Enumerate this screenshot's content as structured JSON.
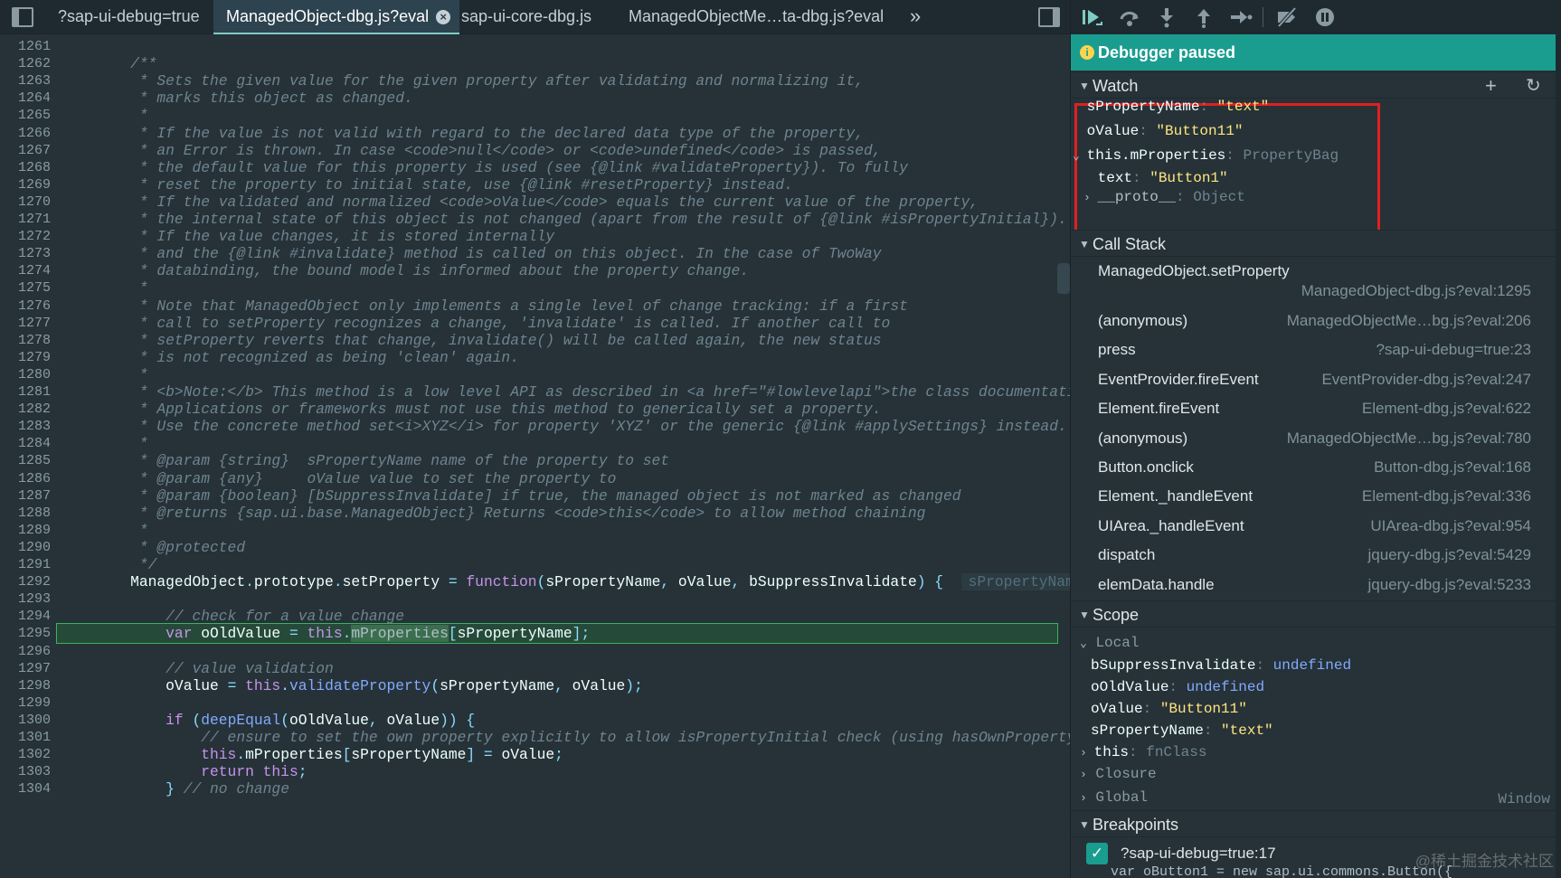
{
  "editor": {
    "tabs": [
      {
        "label": "?sap-ui-debug=true",
        "active": false
      },
      {
        "label": "ManagedObject-dbg.js?eval",
        "active": true
      },
      {
        "label": "sap-ui-core-dbg.js",
        "active": false
      },
      {
        "label": "ManagedObjectMe…ta-dbg.js?eval",
        "active": false
      }
    ],
    "more_tabs": "»",
    "current_line": 1295,
    "inline_value": "sPropertyName",
    "lines": [
      {
        "n": "1261",
        "segs": []
      },
      {
        "n": "1262",
        "segs": [
          {
            "c": "cm",
            "t": "    /**"
          }
        ]
      },
      {
        "n": "1263",
        "segs": [
          {
            "c": "cm",
            "t": "     * Sets the given value for the given property after validating and normalizing it,"
          }
        ]
      },
      {
        "n": "1264",
        "segs": [
          {
            "c": "cm",
            "t": "     * marks this object as changed."
          }
        ]
      },
      {
        "n": "1265",
        "segs": [
          {
            "c": "cm",
            "t": "     *"
          }
        ]
      },
      {
        "n": "1266",
        "segs": [
          {
            "c": "cm",
            "t": "     * If the value is not valid with regard to the declared data type of the property,"
          }
        ]
      },
      {
        "n": "1267",
        "segs": [
          {
            "c": "cm",
            "t": "     * an Error is thrown. In case <code>null</code> or <code>undefined</code> is passed,"
          }
        ]
      },
      {
        "n": "1268",
        "segs": [
          {
            "c": "cm",
            "t": "     * the default value for this property is used (see {@link #validateProperty}). To fully"
          }
        ]
      },
      {
        "n": "1269",
        "segs": [
          {
            "c": "cm",
            "t": "     * reset the property to initial state, use {@link #resetProperty} instead."
          }
        ]
      },
      {
        "n": "1270",
        "segs": [
          {
            "c": "cm",
            "t": "     * If the validated and normalized <code>oValue</code> equals the current value of the property,"
          }
        ]
      },
      {
        "n": "1271",
        "segs": [
          {
            "c": "cm",
            "t": "     * the internal state of this object is not changed (apart from the result of {@link #isPropertyInitial})."
          }
        ]
      },
      {
        "n": "1272",
        "segs": [
          {
            "c": "cm",
            "t": "     * If the value changes, it is stored internally"
          }
        ]
      },
      {
        "n": "1273",
        "segs": [
          {
            "c": "cm",
            "t": "     * and the {@link #invalidate} method is called on this object. In the case of TwoWay"
          }
        ]
      },
      {
        "n": "1274",
        "segs": [
          {
            "c": "cm",
            "t": "     * databinding, the bound model is informed about the property change."
          }
        ]
      },
      {
        "n": "1275",
        "segs": [
          {
            "c": "cm",
            "t": "     *"
          }
        ]
      },
      {
        "n": "1276",
        "segs": [
          {
            "c": "cm",
            "t": "     * Note that ManagedObject only implements a single level of change tracking: if a first"
          }
        ]
      },
      {
        "n": "1277",
        "segs": [
          {
            "c": "cm",
            "t": "     * call to setProperty recognizes a change, 'invalidate' is called. If another call to"
          }
        ]
      },
      {
        "n": "1278",
        "segs": [
          {
            "c": "cm",
            "t": "     * setProperty reverts that change, invalidate() will be called again, the new status"
          }
        ]
      },
      {
        "n": "1279",
        "segs": [
          {
            "c": "cm",
            "t": "     * is not recognized as being 'clean' again."
          }
        ]
      },
      {
        "n": "1280",
        "segs": [
          {
            "c": "cm",
            "t": "     *"
          }
        ]
      },
      {
        "n": "1281",
        "segs": [
          {
            "c": "cm",
            "t": "     * <b>Note:</b> This method is a low level API as described in <a href=\"#lowlevelapi\">the class documentation"
          }
        ]
      },
      {
        "n": "1282",
        "segs": [
          {
            "c": "cm",
            "t": "     * Applications or frameworks must not use this method to generically set a property."
          }
        ]
      },
      {
        "n": "1283",
        "segs": [
          {
            "c": "cm",
            "t": "     * Use the concrete method set<i>XYZ</i> for property 'XYZ' or the generic {@link #applySettings} instead."
          }
        ]
      },
      {
        "n": "1284",
        "segs": [
          {
            "c": "cm",
            "t": "     *"
          }
        ]
      },
      {
        "n": "1285",
        "segs": [
          {
            "c": "cm",
            "t": "     * @param {string}  sPropertyName name of the property to set"
          }
        ]
      },
      {
        "n": "1286",
        "segs": [
          {
            "c": "cm",
            "t": "     * @param {any}     oValue value to set the property to"
          }
        ]
      },
      {
        "n": "1287",
        "segs": [
          {
            "c": "cm",
            "t": "     * @param {boolean} [bSuppressInvalidate] if true, the managed object is not marked as changed"
          }
        ]
      },
      {
        "n": "1288",
        "segs": [
          {
            "c": "cm",
            "t": "     * @returns {sap.ui.base.ManagedObject} Returns <code>this</code> to allow method chaining"
          }
        ]
      },
      {
        "n": "1289",
        "segs": [
          {
            "c": "cm",
            "t": "     *"
          }
        ]
      },
      {
        "n": "1290",
        "segs": [
          {
            "c": "cm",
            "t": "     * @protected"
          }
        ]
      },
      {
        "n": "1291",
        "segs": [
          {
            "c": "cm",
            "t": "     */"
          }
        ]
      },
      {
        "n": "1292",
        "segs": [
          {
            "c": "vr",
            "t": "    ManagedObject"
          },
          {
            "c": "pu",
            "t": "."
          },
          {
            "c": "vr",
            "t": "prototype"
          },
          {
            "c": "pu",
            "t": "."
          },
          {
            "c": "vr",
            "t": "setProperty "
          },
          {
            "c": "pu",
            "t": "= "
          },
          {
            "c": "kw",
            "t": "function"
          },
          {
            "c": "pu",
            "t": "("
          },
          {
            "c": "vr",
            "t": "sPropertyName"
          },
          {
            "c": "pu",
            "t": ", "
          },
          {
            "c": "vr",
            "t": "oValue"
          },
          {
            "c": "pu",
            "t": ", "
          },
          {
            "c": "vr",
            "t": "bSuppressInvalidate"
          },
          {
            "c": "pu",
            "t": ") {"
          }
        ],
        "inline": true
      },
      {
        "n": "1293",
        "segs": []
      },
      {
        "n": "1294",
        "segs": [
          {
            "c": "cm",
            "t": "        // check for a value change"
          }
        ]
      },
      {
        "n": "1295",
        "segs": [
          {
            "c": "kw",
            "t": "        var "
          },
          {
            "c": "vr",
            "t": "oOldValue "
          },
          {
            "c": "pu",
            "t": "= "
          },
          {
            "c": "kw",
            "t": "this"
          },
          {
            "c": "pu",
            "t": "."
          },
          {
            "c": "hl",
            "t": "mProperties"
          },
          {
            "c": "pu",
            "t": "["
          },
          {
            "c": "vr",
            "t": "sPropertyName"
          },
          {
            "c": "pu",
            "t": "];"
          }
        ]
      },
      {
        "n": "1296",
        "segs": []
      },
      {
        "n": "1297",
        "segs": [
          {
            "c": "cm",
            "t": "        // value validation"
          }
        ]
      },
      {
        "n": "1298",
        "segs": [
          {
            "c": "vr",
            "t": "        oValue "
          },
          {
            "c": "pu",
            "t": "= "
          },
          {
            "c": "kw",
            "t": "this"
          },
          {
            "c": "pu",
            "t": "."
          },
          {
            "c": "fn",
            "t": "validateProperty"
          },
          {
            "c": "pu",
            "t": "("
          },
          {
            "c": "vr",
            "t": "sPropertyName"
          },
          {
            "c": "pu",
            "t": ", "
          },
          {
            "c": "vr",
            "t": "oValue"
          },
          {
            "c": "pu",
            "t": ");"
          }
        ]
      },
      {
        "n": "1299",
        "segs": []
      },
      {
        "n": "1300",
        "segs": [
          {
            "c": "kw",
            "t": "        if "
          },
          {
            "c": "pu",
            "t": "("
          },
          {
            "c": "fn",
            "t": "deepEqual"
          },
          {
            "c": "pu",
            "t": "("
          },
          {
            "c": "vr",
            "t": "oOldValue"
          },
          {
            "c": "pu",
            "t": ", "
          },
          {
            "c": "vr",
            "t": "oValue"
          },
          {
            "c": "pu",
            "t": ")) {"
          }
        ]
      },
      {
        "n": "1301",
        "segs": [
          {
            "c": "cm",
            "t": "            // ensure to set the own property explicitly to allow isPropertyInitial check (using hasOwnProperty o"
          }
        ]
      },
      {
        "n": "1302",
        "segs": [
          {
            "c": "kw",
            "t": "            this"
          },
          {
            "c": "pu",
            "t": "."
          },
          {
            "c": "vr",
            "t": "mProperties"
          },
          {
            "c": "pu",
            "t": "["
          },
          {
            "c": "vr",
            "t": "sPropertyName"
          },
          {
            "c": "pu",
            "t": "] = "
          },
          {
            "c": "vr",
            "t": "oValue"
          },
          {
            "c": "pu",
            "t": ";"
          }
        ]
      },
      {
        "n": "1303",
        "segs": [
          {
            "c": "kw",
            "t": "            return this"
          },
          {
            "c": "pu",
            "t": ";"
          }
        ]
      },
      {
        "n": "1304",
        "segs": [
          {
            "c": "pu",
            "t": "        } "
          },
          {
            "c": "cm",
            "t": "// no change"
          }
        ]
      }
    ]
  },
  "debugger": {
    "status": "Debugger paused",
    "sections": {
      "watch": "Watch",
      "call_stack": "Call Stack",
      "scope": "Scope",
      "breakpoints": "Breakpoints"
    },
    "watch": [
      {
        "name": "sPropertyName",
        "value": "\"text\"",
        "kind": "str",
        "indent": 0,
        "expander": ""
      },
      {
        "name": "oValue",
        "value": "\"Button11\"",
        "kind": "str",
        "indent": 0,
        "expander": ""
      },
      {
        "name": "this.mProperties",
        "value": "PropertyBag",
        "kind": "obj",
        "indent": 0,
        "expander": "open"
      },
      {
        "name": "text",
        "value": "\"Button1\"",
        "kind": "str",
        "indent": 1,
        "expander": ""
      },
      {
        "name": "__proto__",
        "value": "Object",
        "kind": "obj",
        "indent": 1,
        "expander": "closed",
        "dim": true
      }
    ],
    "call_stack": [
      {
        "fn": "ManagedObject.setProperty",
        "loc": "ManagedObject-dbg.js?eval:1295",
        "wrap": true
      },
      {
        "fn": "(anonymous)",
        "loc": "ManagedObjectMe…bg.js?eval:206"
      },
      {
        "fn": "press",
        "loc": "?sap-ui-debug=true:23"
      },
      {
        "fn": "EventProvider.fireEvent",
        "loc": "EventProvider-dbg.js?eval:247"
      },
      {
        "fn": "Element.fireEvent",
        "loc": "Element-dbg.js?eval:622"
      },
      {
        "fn": "(anonymous)",
        "loc": "ManagedObjectMe…bg.js?eval:780"
      },
      {
        "fn": "Button.onclick",
        "loc": "Button-dbg.js?eval:168"
      },
      {
        "fn": "Element._handleEvent",
        "loc": "Element-dbg.js?eval:336"
      },
      {
        "fn": "UIArea._handleEvent",
        "loc": "UIArea-dbg.js?eval:954"
      },
      {
        "fn": "dispatch",
        "loc": "jquery-dbg.js?eval:5429"
      },
      {
        "fn": "elemData.handle",
        "loc": "jquery-dbg.js?eval:5233"
      }
    ],
    "scope": {
      "local_label": "Local",
      "local": [
        {
          "name": "bSuppressInvalidate",
          "value": "undefined",
          "kind": "undef"
        },
        {
          "name": "oOldValue",
          "value": "undefined",
          "kind": "undef"
        },
        {
          "name": "oValue",
          "value": "\"Button11\"",
          "kind": "str"
        },
        {
          "name": "sPropertyName",
          "value": "\"text\"",
          "kind": "str"
        },
        {
          "name": "this",
          "value": "fnClass",
          "kind": "obj",
          "expander": "closed"
        }
      ],
      "closure_label": "Closure",
      "global_label": "Global",
      "global_value": "Window"
    },
    "breakpoints": [
      {
        "label": "?sap-ui-debug=true:17",
        "checked": true,
        "code": "var oButton1 = new sap.ui.commons.Button({"
      }
    ]
  },
  "watermark": "@稀土掘金技术社区"
}
